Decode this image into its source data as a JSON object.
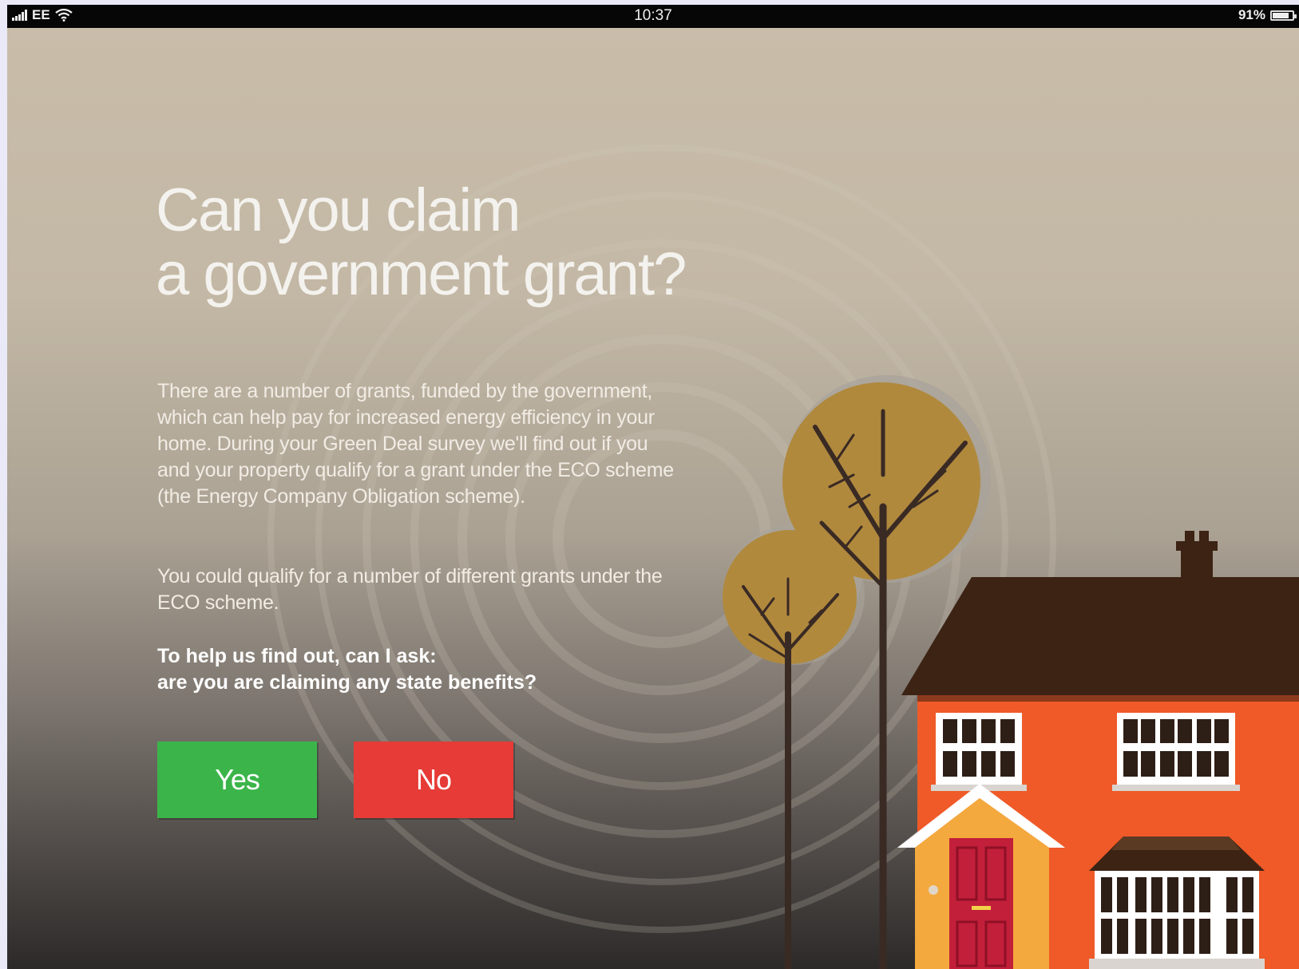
{
  "status_bar": {
    "carrier": "EE",
    "time": "10:37",
    "battery": "91%",
    "battery_level": 0.91
  },
  "main": {
    "heading_line1": "Can you claim",
    "heading_line2": "a government grant?",
    "paragraph1": "There are a number of grants, funded by the government, which can help pay for increased energy efficiency in your home. During your Green Deal survey we'll find out if you and your property qualify for a grant under the ECO scheme (the Energy Company Obligation scheme).",
    "paragraph2": "You could qualify for a number of different grants under the ECO scheme.",
    "question_line1": "To help us find out, can I ask:",
    "question_line2": "are you are claiming any state benefits?"
  },
  "buttons": {
    "yes_label": "Yes",
    "no_label": "No"
  },
  "colors": {
    "yes": "#3bb54a",
    "no": "#e63b36",
    "house": "#ef5a28",
    "roof": "#3c2314",
    "tree": "#b0893d"
  }
}
